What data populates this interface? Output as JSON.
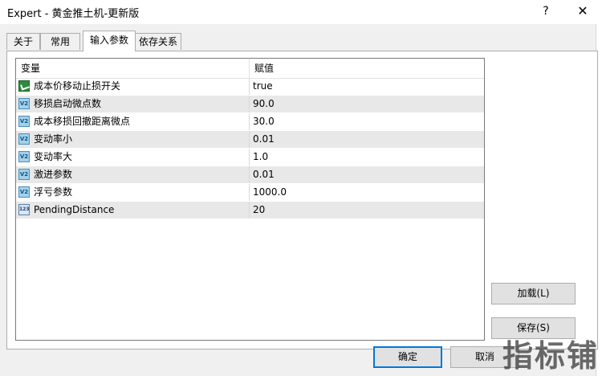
{
  "window": {
    "title": "Expert - 黄金推土机-更新版",
    "help_label": "?",
    "close_label": "✕"
  },
  "tabs": [
    {
      "label": "关于"
    },
    {
      "label": "常用"
    },
    {
      "label": "输入参数",
      "active": true
    },
    {
      "label": "依存关系"
    }
  ],
  "grid": {
    "headers": {
      "variable": "变量",
      "value": "赋值"
    },
    "rows": [
      {
        "name": "成本价移动止损开关",
        "value": "true",
        "type_icon": "bool-icon"
      },
      {
        "name": "移损启动微点数",
        "value": "90.0",
        "type_icon": "double-icon"
      },
      {
        "name": "成本移损回撤距离微点",
        "value": "30.0",
        "type_icon": "double-icon"
      },
      {
        "name": "变动率小",
        "value": "0.01",
        "type_icon": "double-icon"
      },
      {
        "name": "变动率大",
        "value": "1.0",
        "type_icon": "double-icon"
      },
      {
        "name": "激进参数",
        "value": "0.01",
        "type_icon": "double-icon"
      },
      {
        "name": "浮亏参数",
        "value": "1000.0",
        "type_icon": "double-icon"
      },
      {
        "name": "PendingDistance",
        "value": "20",
        "type_icon": "int-icon"
      }
    ]
  },
  "icon_glyphs": {
    "double": "V2",
    "int": "123"
  },
  "buttons": {
    "load": "加载(L)",
    "save": "保存(S)",
    "ok": "确定",
    "cancel": "取消"
  },
  "watermark": "指标铺"
}
